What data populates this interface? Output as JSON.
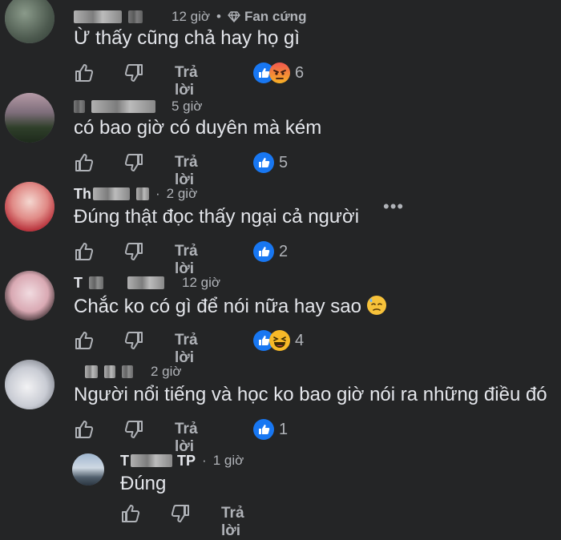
{
  "comments": [
    {
      "author_initial": "",
      "time": "12 giờ",
      "badge": "Fan cứng",
      "text": "Ừ thấy cũng chả hay họ gì",
      "reply_label": "Trả lời",
      "reaction_count": "6",
      "reactions": [
        "like",
        "angry"
      ]
    },
    {
      "author_initial": "",
      "time": "5 giờ",
      "text": "có bao giờ có duyên mà kém",
      "reply_label": "Trả lời",
      "reaction_count": "5",
      "reactions": [
        "like"
      ]
    },
    {
      "author_initial": "Th",
      "time": "2 giờ",
      "text": "Đúng thật đọc thấy ngại cả người",
      "reply_label": "Trả lời",
      "reaction_count": "2",
      "more_label": "•••",
      "reactions": [
        "like"
      ]
    },
    {
      "author_initial": "T",
      "time": "12 giờ",
      "text": "Chắc ko có gì để nói nữa hay sao",
      "reply_label": "Trả lời",
      "reaction_count": "4",
      "reactions": [
        "like",
        "haha"
      ]
    },
    {
      "author_initial": "",
      "time": "2 giờ",
      "text": "Người nổi tiếng và học ko bao giờ nói ra những điều đó",
      "reply_label": "Trả lời",
      "reaction_count": "1",
      "reactions": [
        "like"
      ]
    }
  ],
  "reply": {
    "author_initial": "T",
    "author_suffix": "TP",
    "time": "1 giờ",
    "text": "Đúng",
    "reply_label": "Trả lời"
  },
  "icons": {
    "like": "thumbs-up-icon",
    "dislike": "thumbs-down-icon",
    "badge": "diamond-icon"
  },
  "colors": {
    "background": "#242526",
    "text": "#e4e6eb",
    "muted": "#b0b3b8",
    "like_blue": "#1877f2"
  }
}
